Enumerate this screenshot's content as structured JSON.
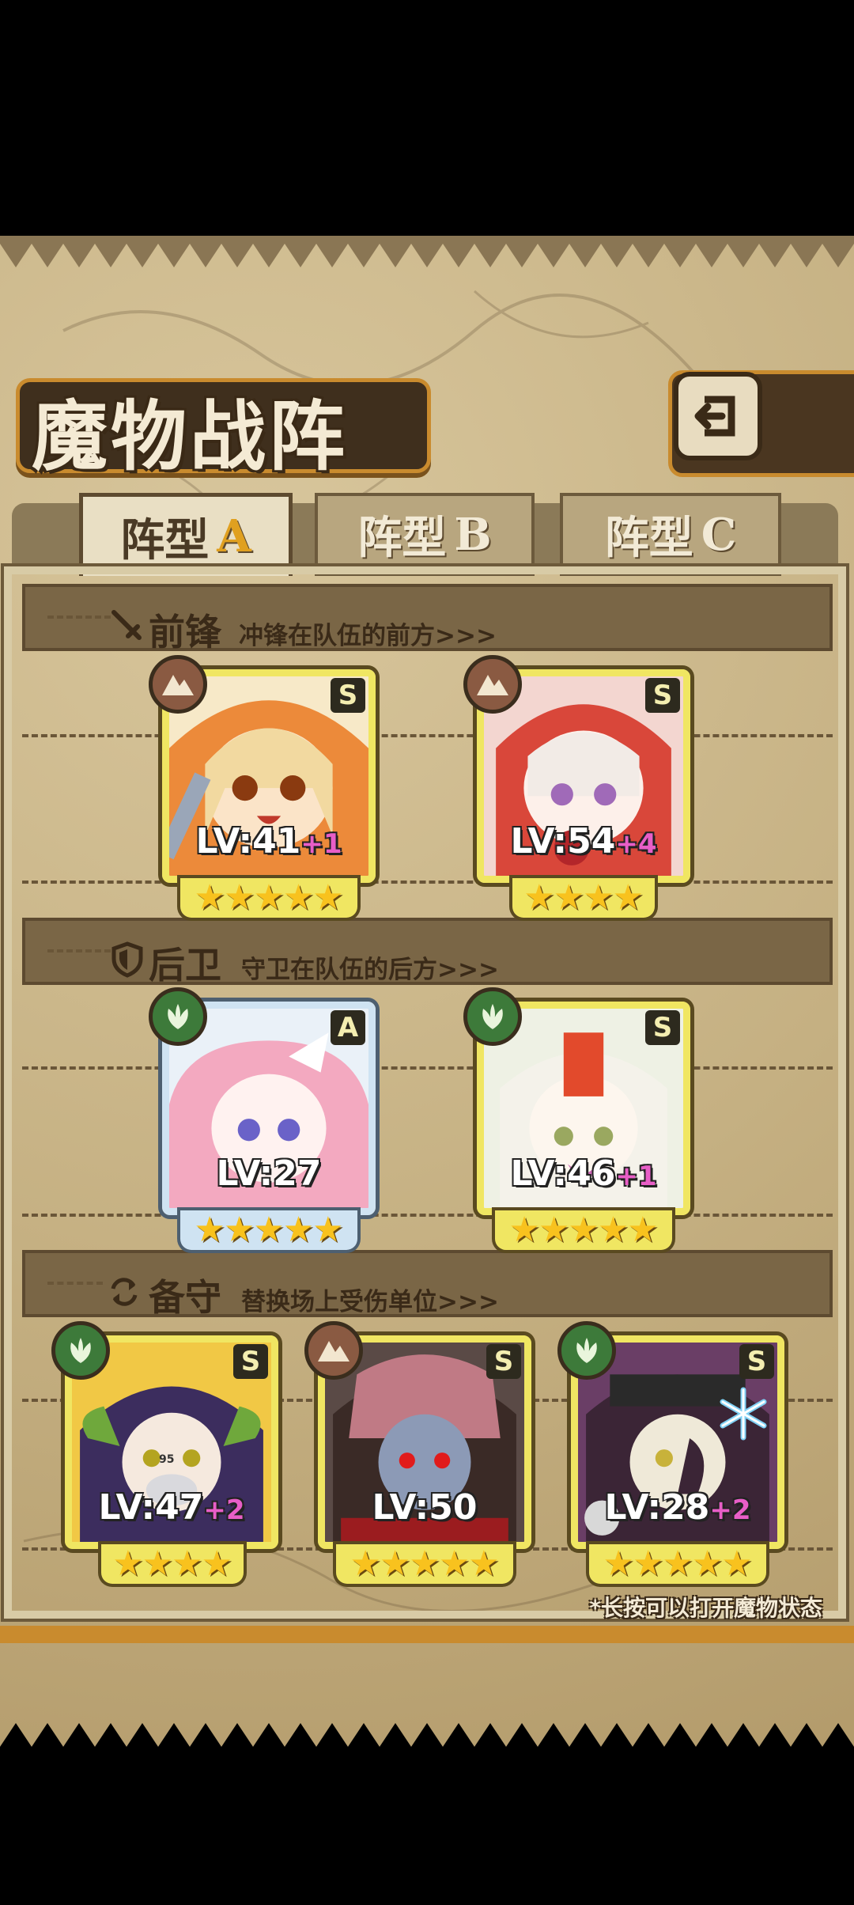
{
  "title": "魔物战阵",
  "tabs": [
    {
      "prefix": "阵型",
      "letter": "A",
      "active": true
    },
    {
      "prefix": "阵型",
      "letter": "B",
      "active": false
    },
    {
      "prefix": "阵型",
      "letter": "C",
      "active": false
    }
  ],
  "sections": {
    "front": {
      "title": "前锋",
      "desc": "冲锋在队伍的前方>>>"
    },
    "rear": {
      "title": "后卫",
      "desc": "守卫在队伍的后方>>>"
    },
    "reserve": {
      "title": "备守",
      "desc": "替换场上受伤单位>>>"
    }
  },
  "cards": [
    {
      "rank": "S",
      "lv": "LV:41",
      "plus": "+1",
      "stars": 5,
      "element": "earth-icon"
    },
    {
      "rank": "S",
      "lv": "LV:54",
      "plus": "+4",
      "stars": 4,
      "element": "earth-icon"
    },
    {
      "rank": "A",
      "lv": "LV:27",
      "plus": "",
      "stars": 5,
      "element": "leaf-icon"
    },
    {
      "rank": "S",
      "lv": "LV:46",
      "plus": "+1",
      "stars": 5,
      "element": "leaf-icon"
    },
    {
      "rank": "S",
      "lv": "LV:47",
      "plus": "+2",
      "stars": 4,
      "element": "leaf-icon"
    },
    {
      "rank": "S",
      "lv": "LV:50",
      "plus": "",
      "stars": 5,
      "element": "earth-icon"
    },
    {
      "rank": "S",
      "lv": "LV:28",
      "plus": "+2",
      "stars": 5,
      "element": "leaf-icon"
    }
  ],
  "badge_text": "95",
  "hint": "*长按可以打开魔物状态",
  "colors": {
    "accent": "#c98b2e",
    "card_s": "#f0e662",
    "card_a": "#cfe3f2",
    "plus": "#e85ec7"
  }
}
